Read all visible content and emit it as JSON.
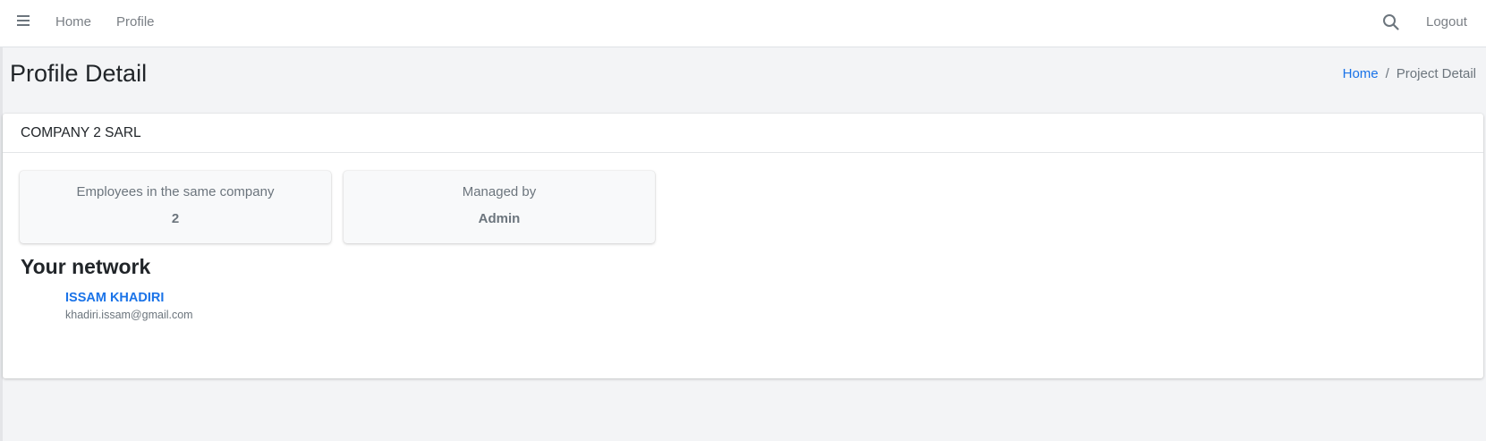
{
  "navbar": {
    "menu_icon": "hamburger-icon",
    "links": [
      {
        "label": "Home"
      },
      {
        "label": "Profile"
      }
    ],
    "search_icon": "search-icon",
    "logout_label": "Logout"
  },
  "page": {
    "title": "Profile Detail",
    "breadcrumb": {
      "home": "Home",
      "separator": "/",
      "current": "Project Detail"
    }
  },
  "card": {
    "header": "COMPANY 2 SARL",
    "stats": [
      {
        "label": "Employees in the same company",
        "value": "2"
      },
      {
        "label": "Managed by",
        "value": "Admin"
      }
    ],
    "network_title": "Your network",
    "network": [
      {
        "name": "ISSAM KHADIRI",
        "email": "khadiri.issam@gmail.com"
      }
    ]
  },
  "colors": {
    "accent": "#1a73e8",
    "background": "#f3f4f6",
    "muted_text": "#6c757d"
  }
}
